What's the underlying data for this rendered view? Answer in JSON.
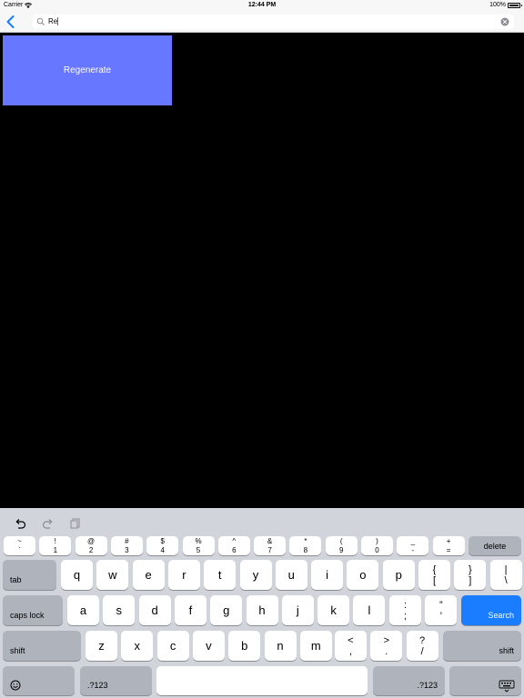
{
  "status": {
    "carrier": "Carrier",
    "time": "12:44 PM",
    "battery": "100%",
    "battery_level": 1.0
  },
  "search": {
    "value": "Re"
  },
  "content": {
    "regenerate_label": "Regenerate",
    "regenerate_color": "#6877ff"
  },
  "keyboard": {
    "row0": [
      {
        "top": "~",
        "bottom": "`"
      },
      {
        "top": "!",
        "bottom": "1"
      },
      {
        "top": "@",
        "bottom": "2"
      },
      {
        "top": "#",
        "bottom": "3"
      },
      {
        "top": "$",
        "bottom": "4"
      },
      {
        "top": "%",
        "bottom": "5"
      },
      {
        "top": "^",
        "bottom": "6"
      },
      {
        "top": "&",
        "bottom": "7"
      },
      {
        "top": "*",
        "bottom": "8"
      },
      {
        "top": "(",
        "bottom": "9"
      },
      {
        "top": ")",
        "bottom": "0"
      },
      {
        "top": "_",
        "bottom": "-"
      },
      {
        "top": "+",
        "bottom": "="
      }
    ],
    "delete": "delete",
    "tab": "tab",
    "row1": [
      "q",
      "w",
      "e",
      "r",
      "t",
      "y",
      "u",
      "i",
      "o",
      "p"
    ],
    "row1_extra": [
      {
        "top": "{",
        "bottom": "["
      },
      {
        "top": "}",
        "bottom": "]"
      },
      {
        "top": "|",
        "bottom": "\\"
      }
    ],
    "caps": "caps lock",
    "row2": [
      "a",
      "s",
      "d",
      "f",
      "g",
      "h",
      "j",
      "k",
      "l"
    ],
    "row2_extra": [
      {
        "top": ":",
        "bottom": ";"
      },
      {
        "top": "”",
        "bottom": "’"
      }
    ],
    "search": "Search",
    "shift": "shift",
    "row3": [
      "z",
      "x",
      "c",
      "v",
      "b",
      "n",
      "m"
    ],
    "row3_extra": [
      {
        "top": "<",
        "bottom": ","
      },
      {
        "top": ">",
        "bottom": "."
      },
      {
        "top": "?",
        "bottom": "/"
      }
    ],
    "numbers": ".?123",
    "accent_color": "#1a7cff"
  }
}
